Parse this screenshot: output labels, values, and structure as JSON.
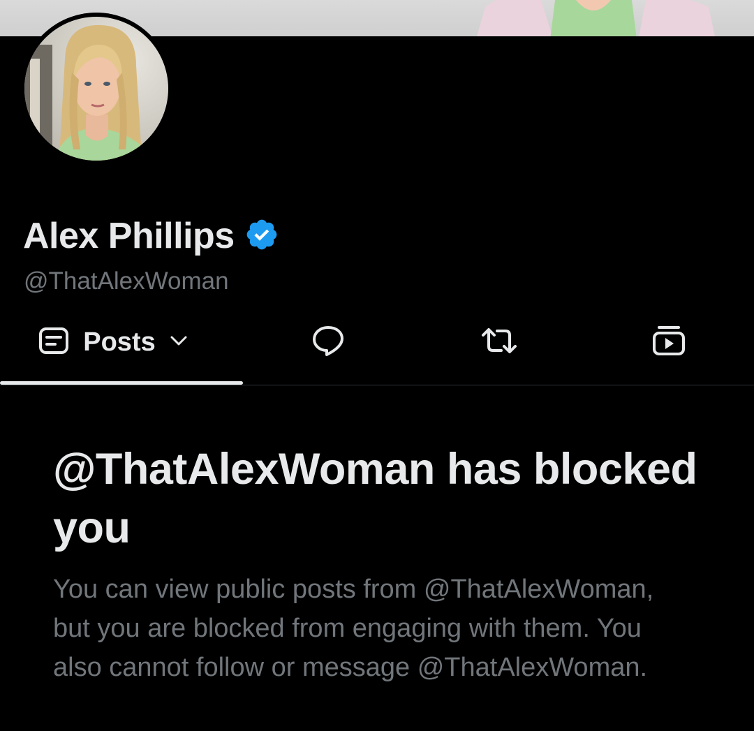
{
  "profile": {
    "display_name": "Alex Phillips",
    "handle": "@ThatAlexWoman",
    "verified": true,
    "verified_color": "#1d9bf0"
  },
  "tabs": {
    "posts_label": "Posts",
    "posts_icon": "posts-icon",
    "posts_dropdown_icon": "chevron-down-icon",
    "replies_icon": "reply-bubble-icon",
    "reposts_icon": "repost-icon",
    "media_icon": "video-icon",
    "active": "posts"
  },
  "blocked_notice": {
    "title": "@ThatAlexWoman has blocked you",
    "body": "You can view public posts from @ThatAlexWoman, but you are blocked from engaging with them. You also cannot follow or message @ThatAlexWoman."
  },
  "colors": {
    "background": "#000000",
    "primary_text": "#e7e9ea",
    "secondary_text": "#71767b",
    "divider": "#2f3336"
  }
}
